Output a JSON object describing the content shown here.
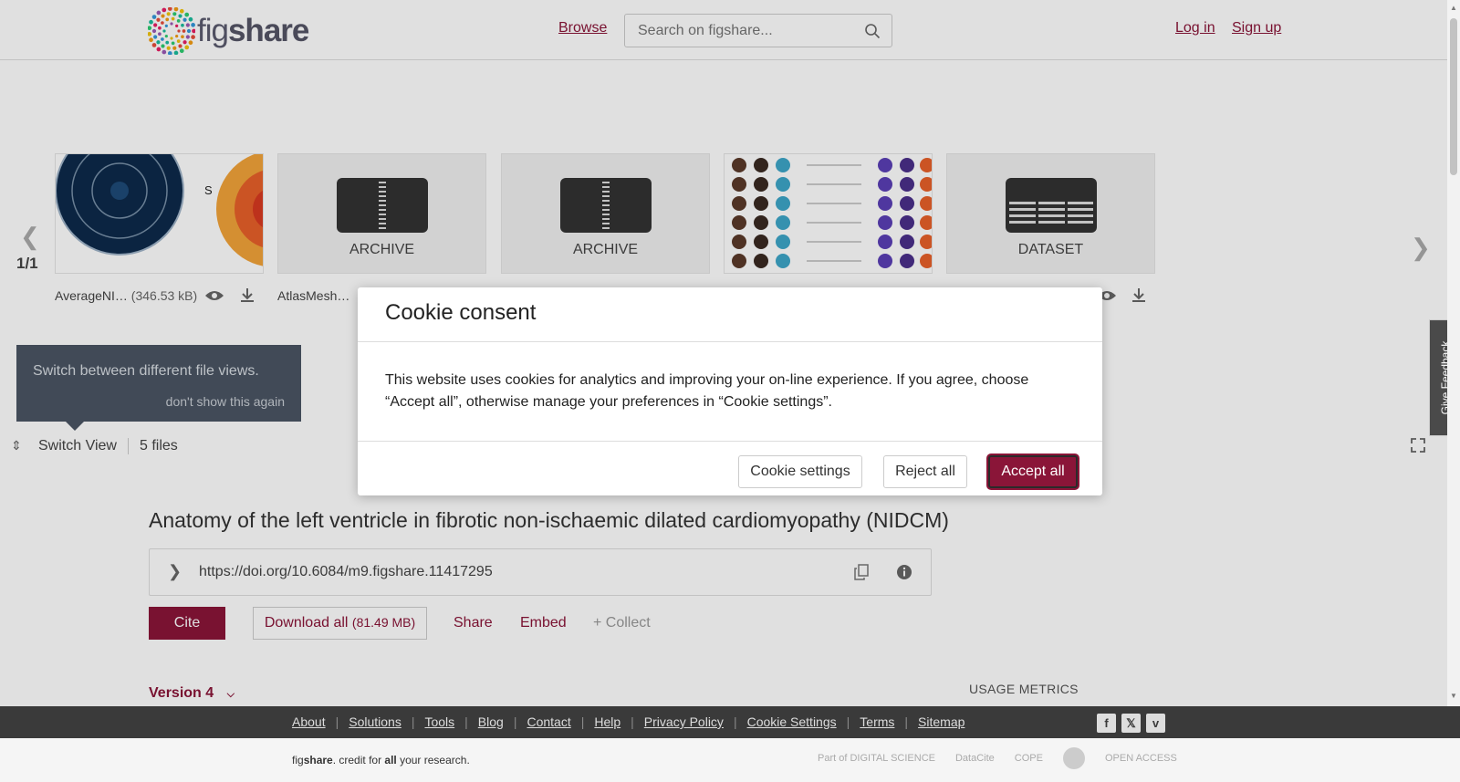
{
  "header": {
    "logo_text_light": "fig",
    "logo_text_bold": "share",
    "browse_label": "Browse",
    "search_placeholder": "Search on figshare...",
    "login_label": "Log in",
    "signup_label": "Sign up"
  },
  "carousel": {
    "counter": "1/1",
    "items": [
      {
        "type_label": "",
        "name": "AverageNI…",
        "size": "(346.53 kB)"
      },
      {
        "type_label": "ARCHIVE",
        "name": "AtlasMesh…",
        "size": ""
      },
      {
        "type_label": "ARCHIVE",
        "name": "",
        "size": ""
      },
      {
        "type_label": "",
        "name": "",
        "size": ""
      },
      {
        "type_label": "DATASET",
        "name": "",
        "size": ""
      }
    ],
    "tooltip_text": "Switch between different file views.",
    "tooltip_dismiss": "don't show this again",
    "switch_view_label": "Switch View",
    "file_count": "5 files"
  },
  "article": {
    "title": "Anatomy of the left ventricle in fibrotic non-ischaemic dilated cardiomyopathy (NIDCM)",
    "doi": "https://doi.org/10.6084/m9.figshare.11417295",
    "cite_label": "Cite",
    "download_label": "Download all",
    "download_size": "(81.49 MB)",
    "share_label": "Share",
    "embed_label": "Embed",
    "collect_label": "+ Collect",
    "version_label": "Version 4",
    "usage_metrics_label": "USAGE METRICS"
  },
  "cookie_modal": {
    "title": "Cookie consent",
    "body": "This website uses cookies for analytics and improving your on-line experience. If you agree, choose “Accept all”, otherwise manage your preferences in “Cookie settings”.",
    "settings_label": "Cookie settings",
    "reject_label": "Reject all",
    "accept_label": "Accept all"
  },
  "feedback_label": "Give Feedback",
  "footer": {
    "links": [
      "About",
      "Solutions",
      "Tools",
      "Blog",
      "Contact",
      "Help",
      "Privacy Policy",
      "Cookie Settings",
      "Terms",
      "Sitemap"
    ],
    "social": [
      "facebook-icon",
      "x-icon",
      "vimeo-icon"
    ],
    "tagline_prefix": "fig",
    "tagline_bold": "share",
    "tagline_mid": ". credit for ",
    "tagline_bold2": "all",
    "tagline_end": " your research.",
    "partners": [
      "Part of DIGITAL SCIENCE",
      "DataCite",
      "COPE",
      "",
      "OPEN ACCESS"
    ]
  },
  "colors": {
    "brand": "#8a1538",
    "footer_dark": "#3a3a3a"
  }
}
